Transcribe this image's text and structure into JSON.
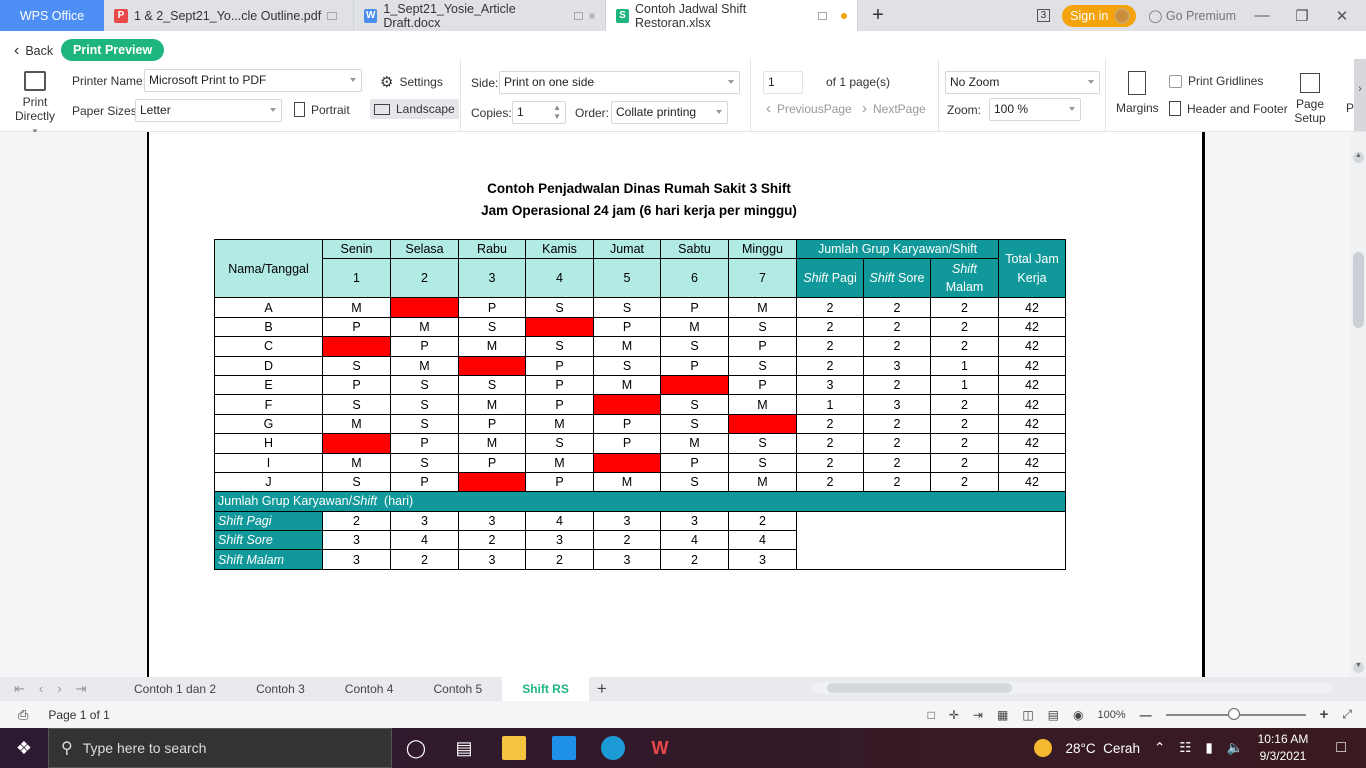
{
  "titlebar": {
    "app_tab": "WPS Office",
    "tabs": [
      {
        "label": "1 & 2_Sept21_Yo...cle Outline.pdf",
        "icon": "pdf-icon",
        "color": "#e9494a"
      },
      {
        "label": "1_Sept21_Yosie_Article Draft.docx",
        "icon": "writer-icon",
        "color": "#4a8ef0"
      },
      {
        "label": "Contoh Jadwal Shift Restoran.xlsx",
        "icon": "spreadsheet-icon",
        "color": "#1fb57e",
        "active": true
      }
    ],
    "window_count": "3",
    "sign_in": "Sign in",
    "go_premium": "Go Premium"
  },
  "toolbar": {
    "back": "Back",
    "print_preview": "Print Preview",
    "print_directly_l1": "Print",
    "print_directly_l2": "Directly",
    "printer_name_label": "Printer Name:",
    "printer_name": "Microsoft Print to PDF",
    "settings": "Settings",
    "paper_sizes_label": "Paper Sizes:",
    "paper_size": "Letter",
    "portrait": "Portrait",
    "landscape": "Landscape",
    "side_label": "Side:",
    "side": "Print on one side",
    "copies_label": "Copies:",
    "copies": "1",
    "order_label": "Order:",
    "order": "Collate printing",
    "page_input": "1",
    "of_pages": "of 1 page(s)",
    "previous_page": "PreviousPage",
    "next_page": "NextPage",
    "zoom_mode": "No Zoom",
    "zoom_label": "Zoom:",
    "zoom_value": "100 %",
    "margins": "Margins",
    "print_gridlines": "Print Gridlines",
    "header_footer": "Header and Footer",
    "page_setup_l1": "Page",
    "page_setup_l2": "Setup",
    "more": "P"
  },
  "sheet": {
    "title1": "Contoh Penjadwalan Dinas Rumah Sakit 3 Shift",
    "title2": "Jam Operasional 24 jam (6 hari kerja per minggu)",
    "header": {
      "name_col": "Nama/Tanggal",
      "days": [
        "Senin",
        "Selasa",
        "Rabu",
        "Kamis",
        "Jumat",
        "Sabtu",
        "Minggu"
      ],
      "dates": [
        "1",
        "2",
        "3",
        "4",
        "5",
        "6",
        "7"
      ],
      "group_header": "Jumlah Grup Karyawan/Shift",
      "shift_pagi_a": "Shift",
      "shift_pagi_b": " Pagi",
      "shift_sore_a": "Shift",
      "shift_sore_b": " Sore",
      "shift_malam_a": "Shift",
      "shift_malam_b": "Malam",
      "total_l1": "Total Jam",
      "total_l2": "Kerja"
    },
    "rows": [
      {
        "name": "A",
        "days": [
          "M",
          "",
          "P",
          "S",
          "S",
          "P",
          "M"
        ],
        "pagi": "2",
        "sore": "2",
        "malam": "2",
        "total": "42"
      },
      {
        "name": "B",
        "days": [
          "P",
          "M",
          "S",
          "",
          "P",
          "M",
          "S"
        ],
        "pagi": "2",
        "sore": "2",
        "malam": "2",
        "total": "42"
      },
      {
        "name": "C",
        "days": [
          "",
          "P",
          "M",
          "S",
          "M",
          "S",
          "P"
        ],
        "pagi": "2",
        "sore": "2",
        "malam": "2",
        "total": "42"
      },
      {
        "name": "D",
        "days": [
          "S",
          "M",
          "",
          "P",
          "S",
          "P",
          "S"
        ],
        "pagi": "2",
        "sore": "3",
        "malam": "1",
        "total": "42"
      },
      {
        "name": "E",
        "days": [
          "P",
          "S",
          "S",
          "P",
          "M",
          "",
          "P"
        ],
        "pagi": "3",
        "sore": "2",
        "malam": "1",
        "total": "42"
      },
      {
        "name": "F",
        "days": [
          "S",
          "S",
          "M",
          "P",
          "",
          "S",
          "M"
        ],
        "pagi": "1",
        "sore": "3",
        "malam": "2",
        "total": "42"
      },
      {
        "name": "G",
        "days": [
          "M",
          "S",
          "P",
          "M",
          "P",
          "S",
          ""
        ],
        "pagi": "2",
        "sore": "2",
        "malam": "2",
        "total": "42"
      },
      {
        "name": "H",
        "days": [
          "",
          "P",
          "M",
          "S",
          "P",
          "M",
          "S"
        ],
        "pagi": "2",
        "sore": "2",
        "malam": "2",
        "total": "42"
      },
      {
        "name": "I",
        "days": [
          "M",
          "S",
          "P",
          "M",
          "",
          "P",
          "S"
        ],
        "pagi": "2",
        "sore": "2",
        "malam": "2",
        "total": "42"
      },
      {
        "name": "J",
        "days": [
          "S",
          "P",
          "",
          "P",
          "M",
          "S",
          "M"
        ],
        "pagi": "2",
        "sore": "2",
        "malam": "2",
        "total": "42"
      }
    ],
    "summary_band_a": "Jumlah Grup Karyawan/",
    "summary_band_b": "Shift",
    "summary_band_c": "  (hari)",
    "summary": [
      {
        "label": "Shift Pagi",
        "values": [
          "2",
          "3",
          "3",
          "4",
          "3",
          "3",
          "2"
        ]
      },
      {
        "label": "Shift Sore",
        "values": [
          "3",
          "4",
          "2",
          "3",
          "2",
          "4",
          "4"
        ]
      },
      {
        "label": "Shift Malam",
        "values": [
          "3",
          "2",
          "3",
          "2",
          "3",
          "2",
          "3"
        ]
      }
    ],
    "colors": {
      "header_light": "#b2ebe4",
      "header_dark": "#10989a",
      "day_off": "#ff0000"
    }
  },
  "sheet_tabs": [
    "Contoh 1 dan 2",
    "Contoh 3",
    "Contoh 4",
    "Contoh 5",
    "Shift RS"
  ],
  "active_sheet": "Shift RS",
  "status": {
    "page": "Page 1 of 1",
    "zoom": "100%"
  },
  "taskbar": {
    "search_placeholder": "Type here to search",
    "weather": "28°C  Cerah",
    "time": "10:16 AM",
    "date": "9/3/2021"
  }
}
